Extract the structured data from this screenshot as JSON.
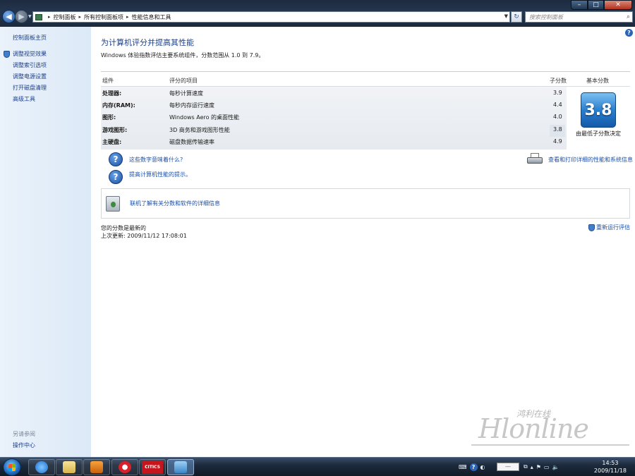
{
  "window": {
    "minimize_glyph": "–",
    "maximize_glyph": "□",
    "close_glyph": "✕"
  },
  "address_bar": {
    "breadcrumbs": [
      "控制面板",
      "所有控制面板项",
      "性能信息和工具"
    ],
    "separator": "▸",
    "search_placeholder": "搜索控制面板"
  },
  "sidebar": {
    "home_link": "控制面板主页",
    "items": [
      {
        "label": "调整视觉效果",
        "icon": "shield-icon"
      },
      {
        "label": "调整索引选项"
      },
      {
        "label": "调整电源设置"
      },
      {
        "label": "打开磁盘清理"
      },
      {
        "label": "高级工具"
      }
    ],
    "see_also_heading": "另请参阅",
    "see_also_items": [
      "操作中心"
    ]
  },
  "main": {
    "title": "为计算机评分并提高其性能",
    "description": "Windows 体验指数评估主要系统组件，分数范围从 1.0 到 7.9。",
    "table": {
      "headers": {
        "component": "组件",
        "rated_item": "评分的项目",
        "subscore": "子分数",
        "base_score": "基本分数"
      },
      "rows": [
        {
          "component": "处理器:",
          "item": "每秒计算速度",
          "subscore": "3.9"
        },
        {
          "component": "内存(RAM):",
          "item": "每秒内存运行速度",
          "subscore": "4.4"
        },
        {
          "component": "图形:",
          "item": "Windows Aero 的桌面性能",
          "subscore": "4.0"
        },
        {
          "component": "游戏图形:",
          "item": "3D 商务和游戏图形性能",
          "subscore": "3.8"
        },
        {
          "component": "主硬盘:",
          "item": "磁盘数据传输速率",
          "subscore": "4.9"
        }
      ],
      "base_score": "3.8",
      "base_caption": "由最低子分数决定"
    },
    "help_links": [
      "这些数字意味着什么?",
      "提高计算机性能的提示。"
    ],
    "print_link": "查看和打印详细的性能和系统信息",
    "online_link": "联机了解有关分数和软件的详细信息",
    "status": "您的分数是最新的",
    "last_update": "上次更新: 2009/11/12 17:08:01",
    "rerun_link": "重新运行评估"
  },
  "watermark": {
    "cn_text": "鸿利在线",
    "logo_text": "Hlonline"
  },
  "taskbar": {
    "citics_label": "CITICS",
    "ime_label": "---",
    "time": "14:53",
    "date": "2009/11/18"
  },
  "colors": {
    "accent": "#1e3f87",
    "link": "#1b4fa8",
    "sidebar_bg": "#e2edf9",
    "score_badge": "#2b7fcf"
  }
}
